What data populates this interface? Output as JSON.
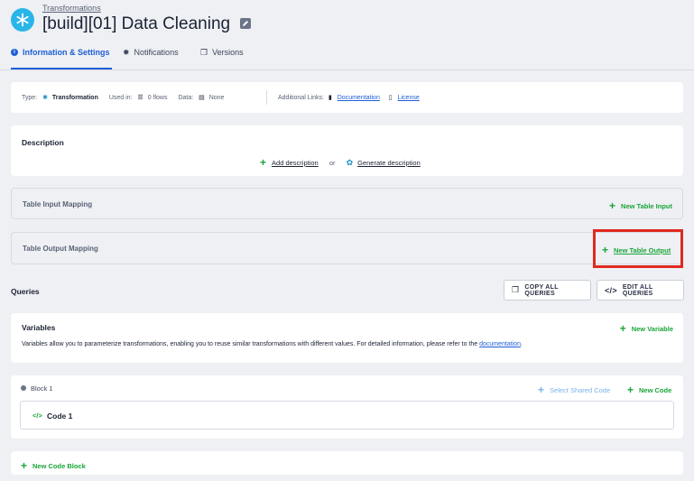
{
  "header": {
    "breadcrumb": "Transformations",
    "title": "[build][01] Data Cleaning"
  },
  "tabs": [
    {
      "label": "Information & Settings",
      "active": true
    },
    {
      "label": "Notifications",
      "active": false
    },
    {
      "label": "Versions",
      "active": false
    }
  ],
  "info": {
    "type_label": "Type:",
    "type_value": "Transformation",
    "used_label": "Used in:",
    "used_value": "0 flows",
    "data_label": "Data:",
    "data_value": "None",
    "links_label": "Additional Links:",
    "link_documentation": "Documentation",
    "link_license": "License"
  },
  "description": {
    "title": "Description",
    "add": "Add description",
    "or": "or",
    "generate": "Generate description"
  },
  "input_mapping": {
    "title": "Table Input Mapping",
    "action": "New Table Input"
  },
  "output_mapping": {
    "title": "Table Output Mapping",
    "action": "New Table Output"
  },
  "queries": {
    "title": "Queries",
    "copy": "COPY ALL QUERIES",
    "edit": "EDIT ALL QUERIES"
  },
  "variables": {
    "title": "Variables",
    "action": "New Variable",
    "text": "Variables allow you to parameterize transformations, enabling you to reuse similar transformations with different values. For detailed information, please refer to the",
    "link": "documentation",
    "end": "."
  },
  "block": {
    "title": "Block 1",
    "shared": "Select Shared Code",
    "new_code": "New Code",
    "code_name": "Code 1"
  },
  "new_block": "New Code Block",
  "colors": {
    "accent": "#1f5fd6",
    "green": "#1aa538",
    "highlight": "#e02a1f",
    "brand": "#29b5e8"
  }
}
